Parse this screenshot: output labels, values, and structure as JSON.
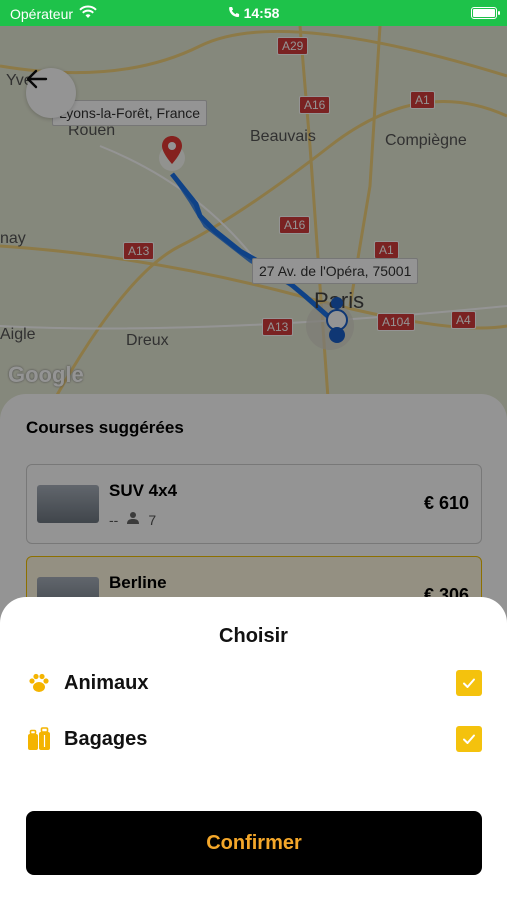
{
  "status_bar": {
    "carrier": "Opérateur",
    "time": "14:58"
  },
  "map": {
    "origin_callout": "Lyons-la-Forêt, France",
    "destination_callout": "27 Av. de l'Opéra, 75001",
    "places": [
      "Rouen",
      "Beauvais",
      "Compiègne",
      "Dreux",
      "Paris",
      "Yve",
      "nay",
      "Aigle"
    ],
    "roads": [
      "A29",
      "A16",
      "A1",
      "A16",
      "A13",
      "A1",
      "A13",
      "A104",
      "A4"
    ],
    "attribution": "Google"
  },
  "rides": {
    "title": "Courses suggérées",
    "items": [
      {
        "name": "SUV 4x4",
        "eta": "--",
        "seats": "7",
        "price": "€ 610"
      },
      {
        "name": "Berline",
        "price": "€ 306"
      }
    ]
  },
  "sheet": {
    "title": "Choisir",
    "options": [
      {
        "label": "Animaux",
        "icon": "paw-icon",
        "checked": true
      },
      {
        "label": "Bagages",
        "icon": "luggage-icon",
        "checked": true
      }
    ],
    "confirm_label": "Confirmer"
  },
  "colors": {
    "accent": "#f4c20d",
    "confirm_text": "#f4a72a",
    "status_bar": "#1ec24a",
    "route": "#1a73e8"
  }
}
